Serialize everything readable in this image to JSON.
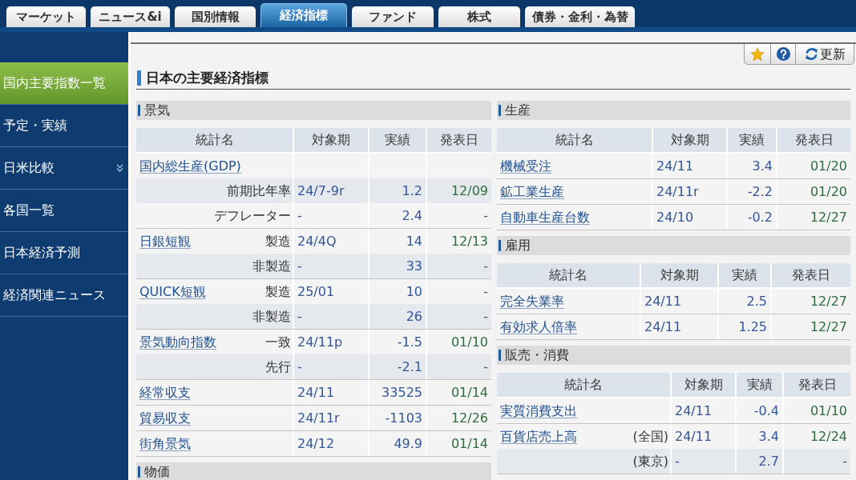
{
  "tabs": [
    {
      "label": "マーケット",
      "selected": false
    },
    {
      "label": "ニュース&i",
      "selected": false
    },
    {
      "label": "国別情報",
      "selected": false
    },
    {
      "label": "経済指標",
      "selected": true
    },
    {
      "label": "ファンド",
      "selected": false
    },
    {
      "label": "株式",
      "selected": false
    },
    {
      "label": "債券・金利・為替",
      "selected": false
    }
  ],
  "sidebar": {
    "items": [
      {
        "label": "国内主要指数一覧",
        "selected": true,
        "submenu": false
      },
      {
        "label": "予定・実績",
        "selected": false,
        "submenu": false
      },
      {
        "label": "日米比較",
        "selected": false,
        "submenu": true
      },
      {
        "label": "各国一覧",
        "selected": false,
        "submenu": false
      },
      {
        "label": "日本経済予測",
        "selected": false,
        "submenu": false
      },
      {
        "label": "経済関連ニュース",
        "selected": false,
        "submenu": false
      }
    ]
  },
  "toolbar": {
    "refresh_label": "更新"
  },
  "page_title": "日本の主要経済指標",
  "panels": [
    {
      "sections": [
        {
          "title": "景気",
          "table": {
            "columns": [
              "統計名",
              "対象期",
              "実績",
              "発表日"
            ],
            "groups": [
              {
                "rows": [
                  {
                    "name": "国内総生産(GDP)",
                    "shaded": false
                  },
                  {
                    "sub": "前期比年率",
                    "period": "24/7-9r",
                    "actual": "1.2",
                    "date": "12/09",
                    "shaded": true
                  },
                  {
                    "sub": "デフレーター",
                    "period": "-",
                    "actual": "2.4",
                    "date": "-",
                    "shaded": false
                  }
                ]
              },
              {
                "rows": [
                  {
                    "name": "日銀短観",
                    "sub": "製造",
                    "period": "24/4Q",
                    "actual": "14",
                    "date": "12/13",
                    "shaded": false
                  },
                  {
                    "sub": "非製造",
                    "period": "-",
                    "actual": "33",
                    "date": "-",
                    "shaded": true
                  }
                ]
              },
              {
                "rows": [
                  {
                    "name": "QUICK短観",
                    "sub": "製造",
                    "period": "25/01",
                    "actual": "10",
                    "date": "-",
                    "shaded": false
                  },
                  {
                    "sub": "非製造",
                    "period": "-",
                    "actual": "26",
                    "date": "-",
                    "shaded": true
                  }
                ]
              },
              {
                "rows": [
                  {
                    "name": "景気動向指数",
                    "sub": "一致",
                    "period": "24/11p",
                    "actual": "-1.5",
                    "date": "01/10",
                    "shaded": false
                  },
                  {
                    "sub": "先行",
                    "period": "-",
                    "actual": "-2.1",
                    "date": "-",
                    "shaded": true
                  }
                ]
              },
              {
                "rows": [
                  {
                    "name": "経常収支",
                    "period": "24/11",
                    "actual": "33525",
                    "date": "01/14",
                    "shaded": false
                  }
                ]
              },
              {
                "rows": [
                  {
                    "name": "貿易収支",
                    "period": "24/11r",
                    "actual": "-1103",
                    "date": "12/26",
                    "shaded": false
                  }
                ]
              },
              {
                "rows": [
                  {
                    "name": "街角景気",
                    "period": "24/12",
                    "actual": "49.9",
                    "date": "01/14",
                    "shaded": false
                  }
                ]
              }
            ]
          }
        },
        {
          "title": "物価"
        }
      ]
    },
    {
      "sections": [
        {
          "title": "生産",
          "table": {
            "columns": [
              "統計名",
              "対象期",
              "実績",
              "発表日"
            ],
            "groups": [
              {
                "rows": [
                  {
                    "name": "機械受注",
                    "period": "24/11",
                    "actual": "3.4",
                    "date": "01/20",
                    "shaded": false
                  }
                ]
              },
              {
                "rows": [
                  {
                    "name": "鉱工業生産",
                    "period": "24/11r",
                    "actual": "-2.2",
                    "date": "01/20",
                    "shaded": false
                  }
                ]
              },
              {
                "rows": [
                  {
                    "name": "自動車生産台数",
                    "period": "24/10",
                    "actual": "-0.2",
                    "date": "12/27",
                    "shaded": false
                  }
                ]
              }
            ]
          }
        },
        {
          "title": "雇用",
          "table": {
            "columns": [
              "統計名",
              "対象期",
              "実績",
              "発表日"
            ],
            "groups": [
              {
                "rows": [
                  {
                    "name": "完全失業率",
                    "period": "24/11",
                    "actual": "2.5",
                    "date": "12/27",
                    "shaded": false
                  }
                ]
              },
              {
                "rows": [
                  {
                    "name": "有効求人倍率",
                    "period": "24/11",
                    "actual": "1.25",
                    "date": "12/27",
                    "shaded": false
                  }
                ]
              }
            ]
          }
        },
        {
          "title": "販売・消費",
          "table": {
            "columns": [
              "統計名",
              "対象期",
              "実績",
              "発表日"
            ],
            "groups": [
              {
                "rows": [
                  {
                    "name": "実質消費支出",
                    "period": "24/11",
                    "actual": "-0.4",
                    "date": "01/10",
                    "shaded": false
                  }
                ]
              },
              {
                "rows": [
                  {
                    "name": "百貨店売上高",
                    "sub": "(全国)",
                    "period": "24/11",
                    "actual": "3.4",
                    "date": "12/24",
                    "shaded": false
                  },
                  {
                    "sub": "(東京)",
                    "period": "-",
                    "actual": "2.7",
                    "date": "-",
                    "shaded": true
                  }
                ]
              }
            ]
          }
        }
      ]
    }
  ]
}
